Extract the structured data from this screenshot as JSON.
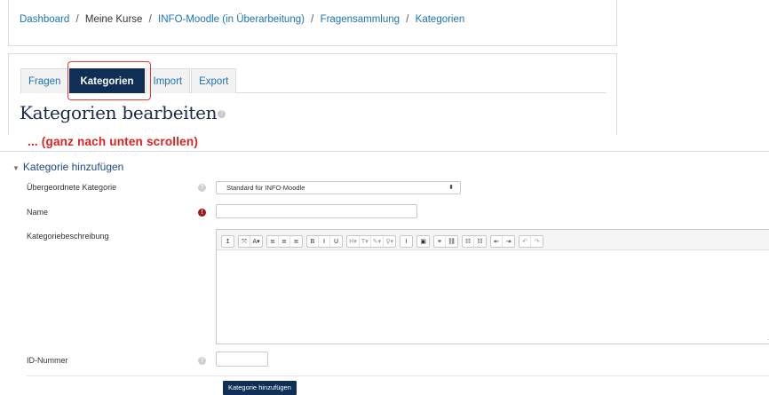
{
  "breadcrumb": {
    "items": [
      "Dashboard",
      "Meine Kurse",
      "INFO-Moodle (in Überarbeitung)",
      "Fragensammlung",
      "Kategorien"
    ],
    "separator": "/"
  },
  "tabs": [
    {
      "label": "Fragen"
    },
    {
      "label": "Kategorien"
    },
    {
      "label": "Import"
    },
    {
      "label": "Export"
    }
  ],
  "page_title": "Kategorien bearbeiten",
  "annotation": "... (ganz nach unten scrollen)",
  "form": {
    "legend": "Kategorie hinzufügen",
    "parent_label": "Übergeordnete Kategorie",
    "parent_value": "Standard für INFO-Moodle",
    "name_label": "Name",
    "name_value": "",
    "description_label": "Kategoriebeschreibung",
    "idnumber_label": "ID-Nummer",
    "idnumber_value": "",
    "submit_label": "Kategorie hinzufügen"
  },
  "toolbar": {
    "groups": [
      [
        "↥"
      ],
      [
        "⤧",
        "A▾"
      ],
      [
        "≡",
        "≡",
        "≡"
      ],
      [
        "B",
        "I",
        "U"
      ],
      [
        "H▾",
        "T▾",
        "✎▾",
        "♀▾"
      ],
      [
        "I"
      ],
      [
        "▣"
      ],
      [
        "⚭",
        "⛓"
      ],
      [
        "☷",
        "☷"
      ],
      [
        "⇤",
        "⇥"
      ],
      [
        "↶",
        "↷"
      ]
    ]
  },
  "colors": {
    "active_tab": "#0f2f57",
    "link": "#1a73b8",
    "required": "#a31515",
    "annotation": "#e02020"
  }
}
